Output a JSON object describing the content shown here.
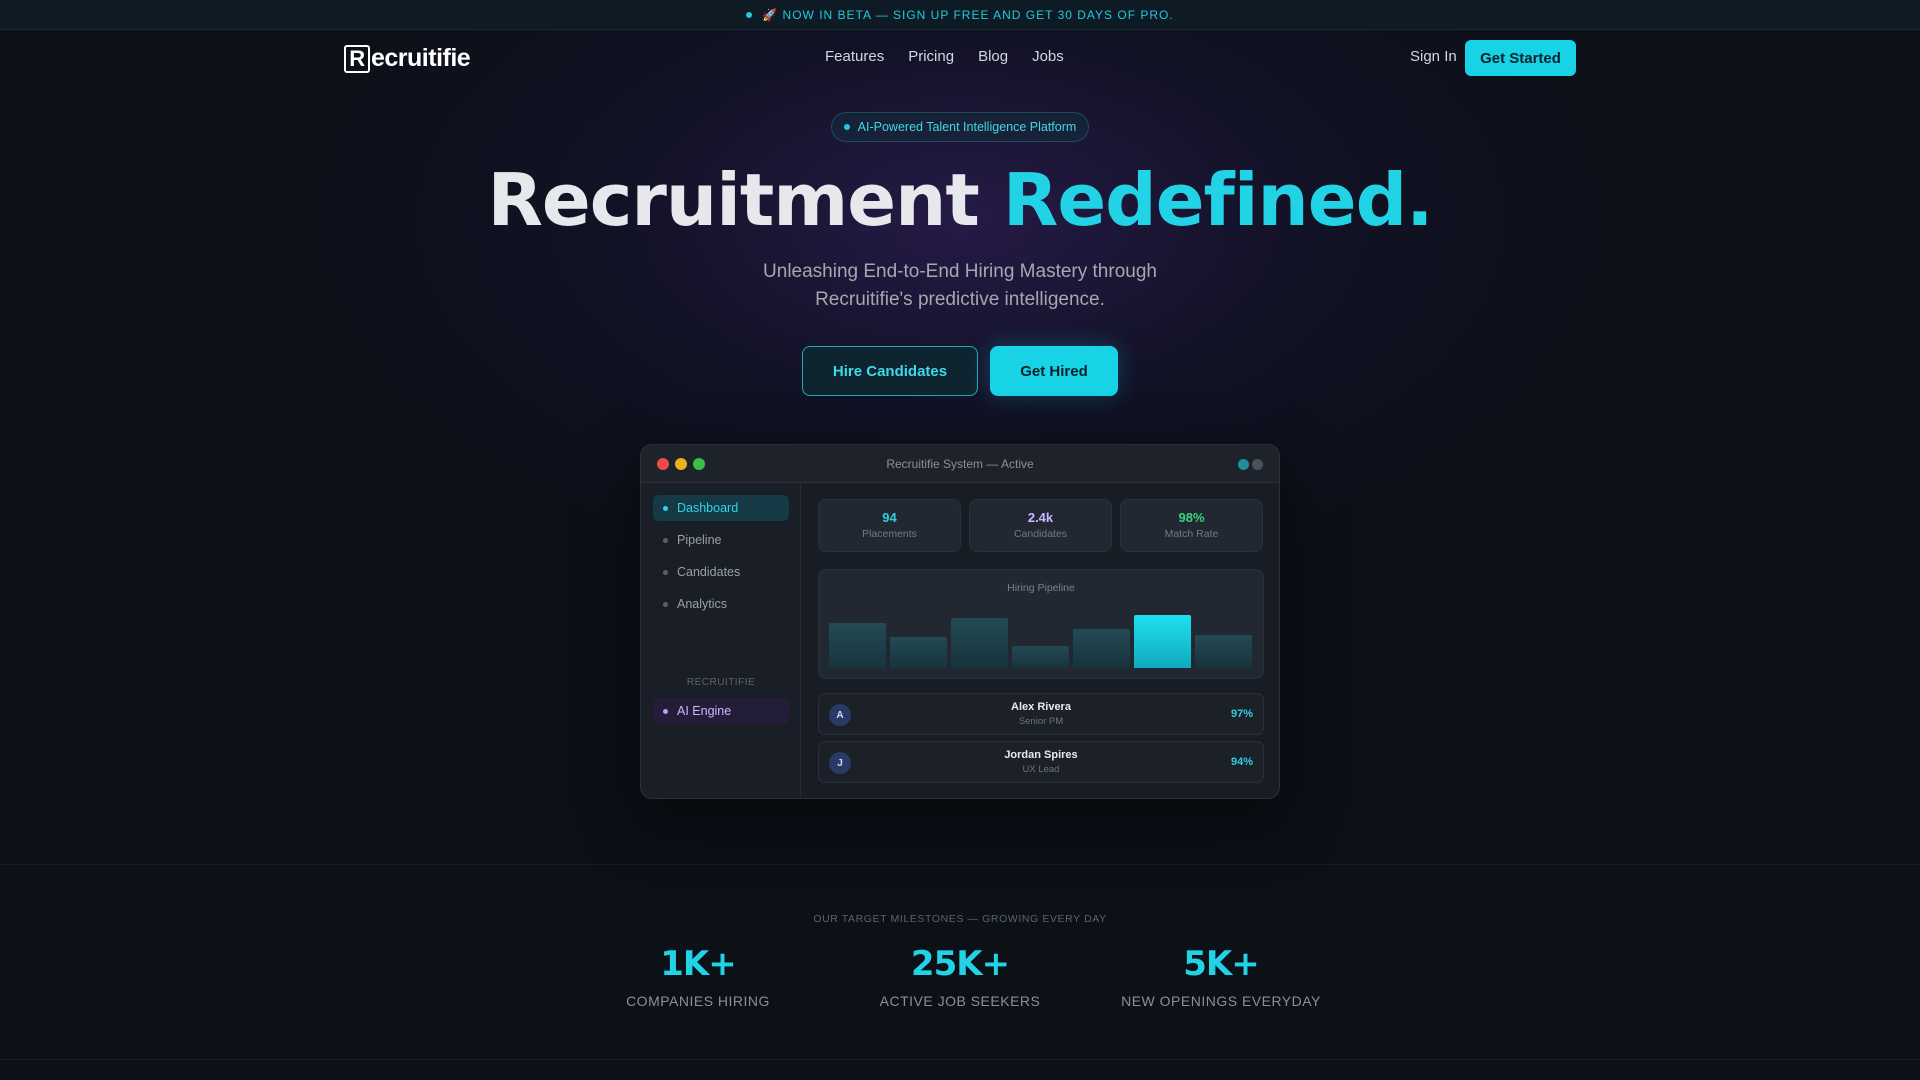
{
  "banner": {
    "text": "🚀 NOW IN BETA — SIGN UP FREE AND GET 30 DAYS OF PRO."
  },
  "nav": {
    "logo_mark": "R",
    "logo_rest": "ecruitifie",
    "links": [
      "Features",
      "Pricing",
      "Blog",
      "Jobs"
    ],
    "sign_in": "Sign In",
    "get_started": "Get Started"
  },
  "hero": {
    "pill": "AI-Powered Talent Intelligence Platform",
    "title_main": "Recruitment ",
    "title_accent": "Redefined.",
    "subtitle_line1": "Unleashing End-to-End Hiring Mastery through",
    "subtitle_line2": "Recruitifie's predictive intelligence.",
    "btn_hire": "Hire Candidates",
    "btn_hired": "Get Hired"
  },
  "preview": {
    "window_title": "Recruitifie System — Active",
    "sidebar": {
      "items": [
        "Dashboard",
        "Pipeline",
        "Candidates",
        "Analytics"
      ],
      "section_label": "RECRUITIFIE",
      "ai_item": "AI Engine"
    },
    "stats": [
      {
        "value": "94",
        "label": "Placements",
        "color": "#2fd0e3"
      },
      {
        "value": "2.4k",
        "label": "Candidates",
        "color": "#c8b8ff"
      },
      {
        "value": "98%",
        "label": "Match Rate",
        "color": "#37d67a"
      }
    ],
    "chart_title": "Hiring Pipeline",
    "chart_data": {
      "type": "bar",
      "values": [
        52,
        36,
        58,
        26,
        46,
        62,
        38
      ],
      "highlight_index": 5
    },
    "candidates": [
      {
        "initial": "A",
        "name": "Alex Rivera",
        "role": "Senior PM",
        "score": "97%"
      },
      {
        "initial": "J",
        "name": "Jordan Spires",
        "role": "UX Lead",
        "score": "94%"
      }
    ]
  },
  "milestones": {
    "heading": "OUR TARGET MILESTONES — GROWING EVERY DAY",
    "items": [
      {
        "value": "1K+",
        "label": "COMPANIES HIRING"
      },
      {
        "value": "25K+",
        "label": "ACTIVE JOB SEEKERS"
      },
      {
        "value": "5K+",
        "label": "NEW OPENINGS EVERYDAY"
      }
    ]
  },
  "colors": {
    "accent": "#18d2e6",
    "background": "#0c1017"
  }
}
